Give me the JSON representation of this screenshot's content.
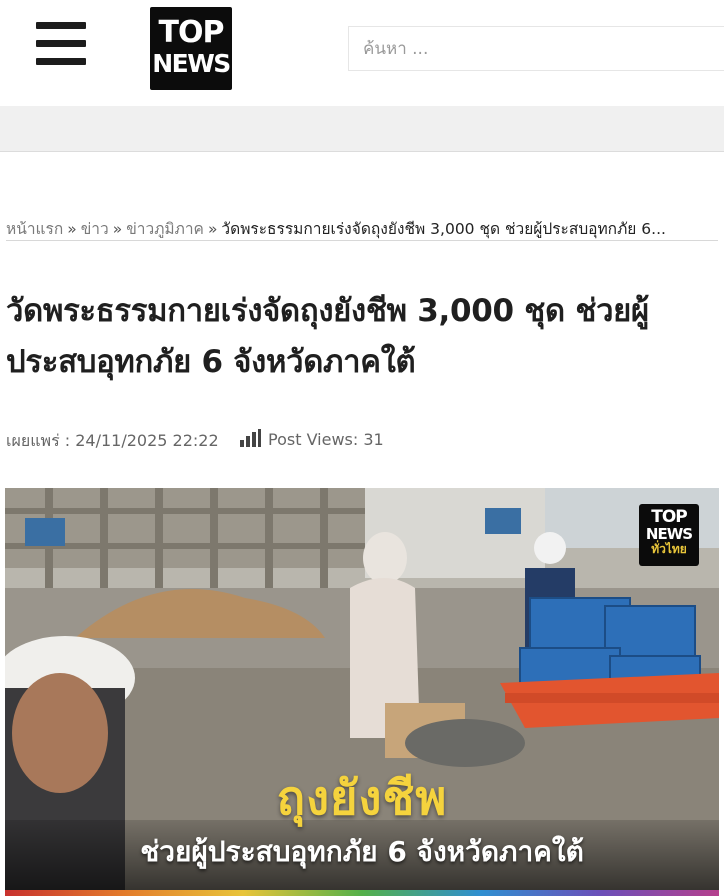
{
  "header": {
    "logo_top": "TOP",
    "logo_bottom": "NEWS",
    "search_placeholder": "ค้นหา ..."
  },
  "breadcrumb": {
    "items": [
      "หน้าแรก",
      "ข่าว",
      "ข่าวภูมิภาค"
    ],
    "separator": "»",
    "current": "วัดพระธรรมกายเร่งจัดถุงยังชีพ 3,000 ชุด ช่วยผู้ประสบอุทกภัย 6..."
  },
  "article": {
    "title": "วัดพระธรรมกายเร่งจัดถุงยังชีพ 3,000 ชุด ช่วยผู้ประสบอุทกภัย 6 จังหวัดภาคใต้",
    "published_label": "เผยแพร่ : 24/11/2025 22:22",
    "views_label": "Post Views: 31"
  },
  "image": {
    "watermark_top": "TOP",
    "watermark_middle": "NEWS",
    "watermark_bottom": "ทั่วไทย",
    "caption_headline": "ถุงยังชีพ",
    "caption_sub": "ช่วยผู้ประสบอุทกภัย 6 จังหวัดภาคใต้"
  },
  "colors": {
    "caption_headline": "#f5d33d",
    "header_bg": "#ffffff",
    "band_bg": "#f0f0f0",
    "title_text": "#1f1f1f"
  },
  "icons": [
    "menu-icon",
    "bar-chart-icon"
  ]
}
